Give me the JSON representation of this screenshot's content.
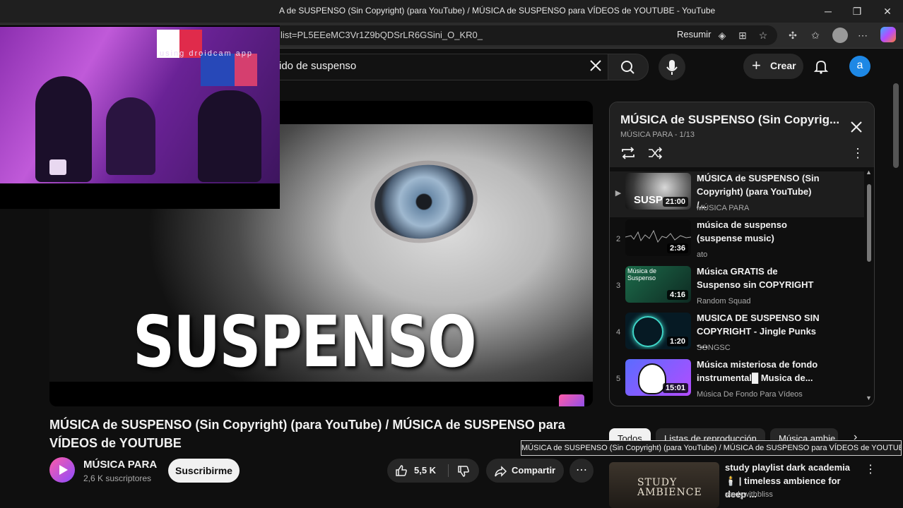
{
  "browser": {
    "window_title": "A de SUSPENSO (Sin Copyright) (para YouTube) / MÚSICA de SUSPENSO para VÍDEOS de YOUTUBE - YouTube",
    "url": "list=PL5EEeMC3Vr1Z9bQDSrLR6GSini_O_KR0_",
    "resume_label": "Resumir"
  },
  "header": {
    "search_query": "ido de suspenso",
    "create_label": "Crear",
    "avatar_letter": "a"
  },
  "webcam": {
    "overlay_text": "using droidcam app"
  },
  "video": {
    "thumbnail_word": "SUSPENSO",
    "title": "MÚSICA de SUSPENSO (Sin Copyright) (para YouTube) / MÚSICA de SUSPENSO para VÍDEOS de YOUTUBE",
    "channel_name": "MÚSICA PARA",
    "subscribers": "2,6 K suscriptores",
    "subscribe_label": "Suscribirme",
    "likes": "5,5 K",
    "share_label": "Compartir",
    "more_label": "⋯"
  },
  "playlist": {
    "title": "MÚSICA de SUSPENSO (Sin Copyrig...",
    "subtitle": "MÚSICA PARA - 1/13",
    "items": [
      {
        "index": "▶",
        "title": "MÚSICA de SUSPENSO (Sin Copyright) (para YouTube) /...",
        "channel": "MÚSICA PARA",
        "duration": "21:00",
        "thumb_text": "SUSP"
      },
      {
        "index": "2",
        "title": "música de suspenso (suspense music)",
        "channel": "ato",
        "duration": "2:36"
      },
      {
        "index": "3",
        "title": "Música GRATIS de Suspenso sin COPYRIGHT",
        "channel": "Random Squad",
        "duration": "4:16",
        "thumb_text": "Música de Suspenso"
      },
      {
        "index": "4",
        "title": "MUSICA DE SUSPENSO SIN COPYRIGHT - Jingle Punks -...",
        "channel": "SONGSC",
        "duration": "1:20"
      },
      {
        "index": "5",
        "title": "Música misteriosa de fondo instrumental█ Musica de...",
        "channel": "Música De Fondo Para Vídeos",
        "duration": "15:01"
      }
    ]
  },
  "chips": [
    "Todos",
    "Listas de reproducción",
    "Música ambie"
  ],
  "tooltip": "MÚSICA de SUSPENSO (Sin Copyright) (para YouTube) / MÚSICA de SUSPENSO para VÍDEOS de YOUTUBE",
  "recommendation": {
    "title": "study playlist dark academia 🕯️ | timeless ambience for deep ...",
    "channel": "studywithbliss",
    "thumb_text": "STUDY AMBIENCE"
  },
  "colors": {
    "background": "#0f0f0f",
    "surface": "#272727",
    "accent_avatar": "#1e88e5"
  }
}
